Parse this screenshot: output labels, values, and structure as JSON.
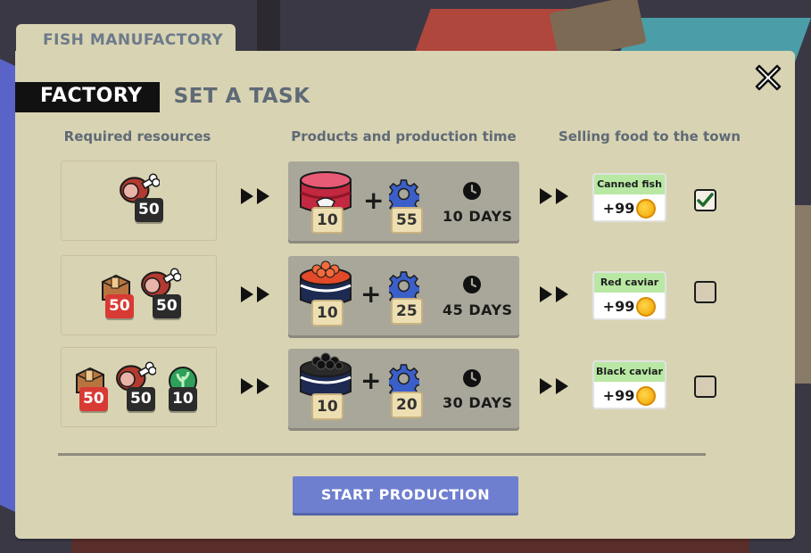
{
  "window": {
    "title": "FISH MANUFACTORY"
  },
  "tabs": {
    "active": "FACTORY",
    "inactive": "SET A TASK"
  },
  "columns": {
    "resources": "Required resources",
    "products": "Products and production time",
    "selling": "Selling food to the town"
  },
  "rows": [
    {
      "resources": [
        {
          "icon": "meat-icon",
          "amount": "50",
          "badge": "dark"
        }
      ],
      "product": {
        "icon": "canned-fish-icon",
        "amount": "10",
        "gear_amount": "55",
        "duration": "10 DAYS"
      },
      "sell": {
        "name": "Canned fish",
        "price": "+99",
        "checked": true
      }
    },
    {
      "resources": [
        {
          "icon": "box-icon",
          "amount": "50",
          "badge": "red"
        },
        {
          "icon": "meat-icon",
          "amount": "50",
          "badge": "dark"
        }
      ],
      "product": {
        "icon": "red-caviar-icon",
        "amount": "10",
        "gear_amount": "25",
        "duration": "45 DAYS"
      },
      "sell": {
        "name": "Red caviar",
        "price": "+99",
        "checked": false
      }
    },
    {
      "resources": [
        {
          "icon": "box-icon",
          "amount": "50",
          "badge": "red"
        },
        {
          "icon": "meat-icon",
          "amount": "50",
          "badge": "dark"
        },
        {
          "icon": "herb-icon",
          "amount": "10",
          "badge": "dark"
        }
      ],
      "product": {
        "icon": "black-caviar-icon",
        "amount": "10",
        "gear_amount": "20",
        "duration": "30 DAYS"
      },
      "sell": {
        "name": "Black caviar",
        "price": "+99",
        "checked": false
      }
    }
  ],
  "actions": {
    "start": "START PRODUCTION"
  },
  "colors": {
    "panel": "#d8d3b2",
    "start_button": "#6f7fd0",
    "sell_label": "#b8e8a4",
    "badge_red": "#d83a34",
    "badge_dark": "#2b2b2b",
    "gear_blue": "#3a5fc8"
  }
}
